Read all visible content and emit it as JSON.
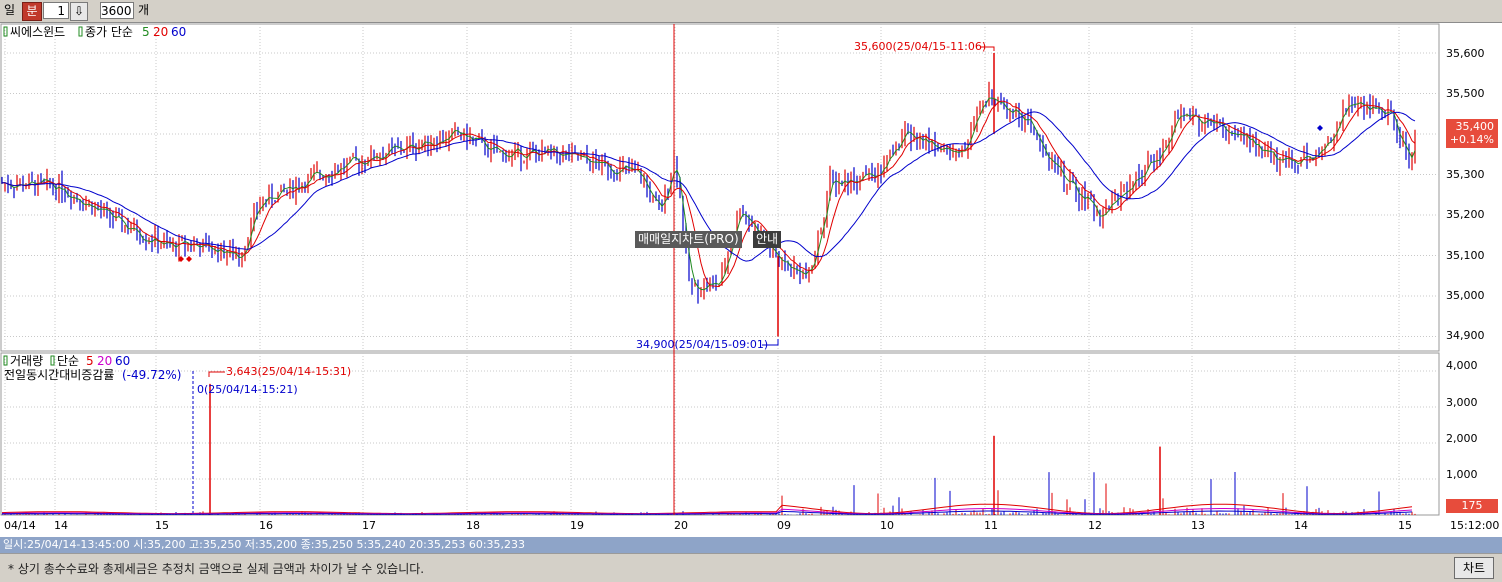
{
  "toolbar": {
    "period_day": "일",
    "period_minute": "분",
    "interval_value": "1",
    "count_value": "3600",
    "count_unit": "개"
  },
  "price_panel": {
    "stock_name": "씨에스윈드",
    "indicator_label": "종가 단순",
    "ma_periods": [
      "5",
      "20",
      "60"
    ],
    "ma_colors": [
      "#228b22",
      "#e00000",
      "#0000cc"
    ],
    "high_label": "35,600(25/04/15-11:06)",
    "low_label": "34,900(25/04/15-09:01)",
    "y_ticks": [
      "35,600",
      "35,500",
      "35,400",
      "35,300",
      "35,200",
      "35,100",
      "35,000",
      "34,900"
    ],
    "current_price": "35,400",
    "current_change": "+0.14%"
  },
  "volume_panel": {
    "title": "거래량",
    "indicator_label": "단순",
    "ma_periods": [
      "5",
      "20",
      "60"
    ],
    "ma_colors": [
      "#e00000",
      "#cc00cc",
      "#0000cc"
    ],
    "compare_label": "전일동시간대비증감률",
    "compare_value": "(-49.72%)",
    "peak_label": "3,643(25/04/14-15:31)",
    "zero_label": "0(25/04/14-15:21)",
    "y_ticks": [
      "4,000",
      "3,000",
      "2,000",
      "1,000"
    ],
    "current_volume": "175"
  },
  "x_axis": {
    "labels": [
      "04/14",
      "14",
      "15",
      "16",
      "17",
      "18",
      "19",
      "20",
      "09",
      "10",
      "11",
      "12",
      "13",
      "14",
      "15"
    ],
    "time": "15:12:00"
  },
  "tooltip": {
    "main": "매매일지차트(PRO)",
    "guide": "안내"
  },
  "status": "일시:25/04/14-13:45:00 시:35,200 고:35,250 저:35,200 종:35,250 5:35,240 20:35,253 60:35,233",
  "notice": "* 상기 총수수료와 총제세금은 추정치 금액으로  실제 금액과 차이가 날 수 있습니다.",
  "chart_button": "차트"
}
